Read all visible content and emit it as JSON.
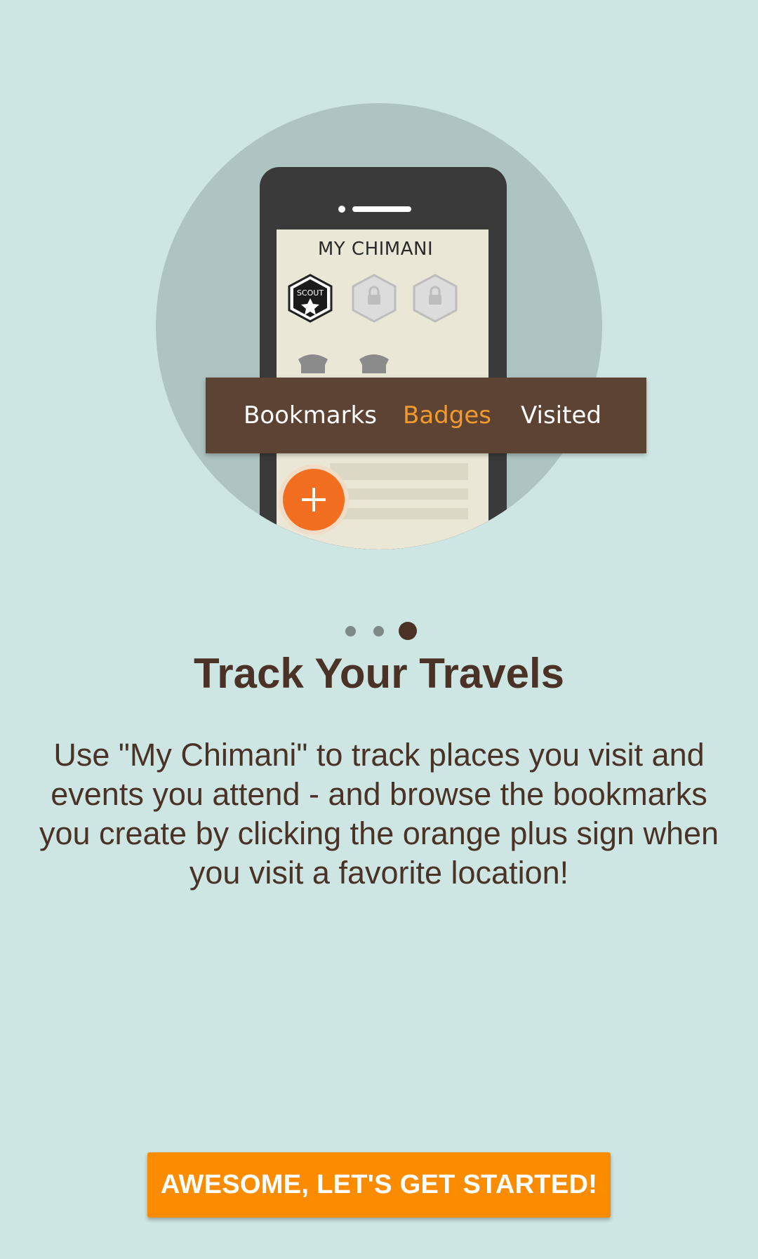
{
  "illustration": {
    "phone_title": "MY CHIMANI",
    "badge_label": "SCOUT",
    "tabs": [
      {
        "label": "Bookmarks",
        "active": false
      },
      {
        "label": "Badges",
        "active": true
      },
      {
        "label": "Visited",
        "active": false
      }
    ],
    "icons": [
      "scout-badge-icon",
      "locked-badge-icon",
      "locked-badge-icon",
      "plus-icon"
    ]
  },
  "pager": {
    "total": 3,
    "current": 3
  },
  "content": {
    "title": "Track Your Travels",
    "body": "Use \"My Chimani\" to track places you visit and events you attend - and browse the bookmarks you create by clicking the orange plus sign when you visit a favorite location!"
  },
  "cta": {
    "label": "AWESOME, LET'S GET STARTED!"
  },
  "colors": {
    "background": "#cee6e3",
    "accent": "#fb8c00",
    "text": "#4a3326",
    "tab_bar": "#5d4333",
    "active_tab": "#f39a2e"
  }
}
